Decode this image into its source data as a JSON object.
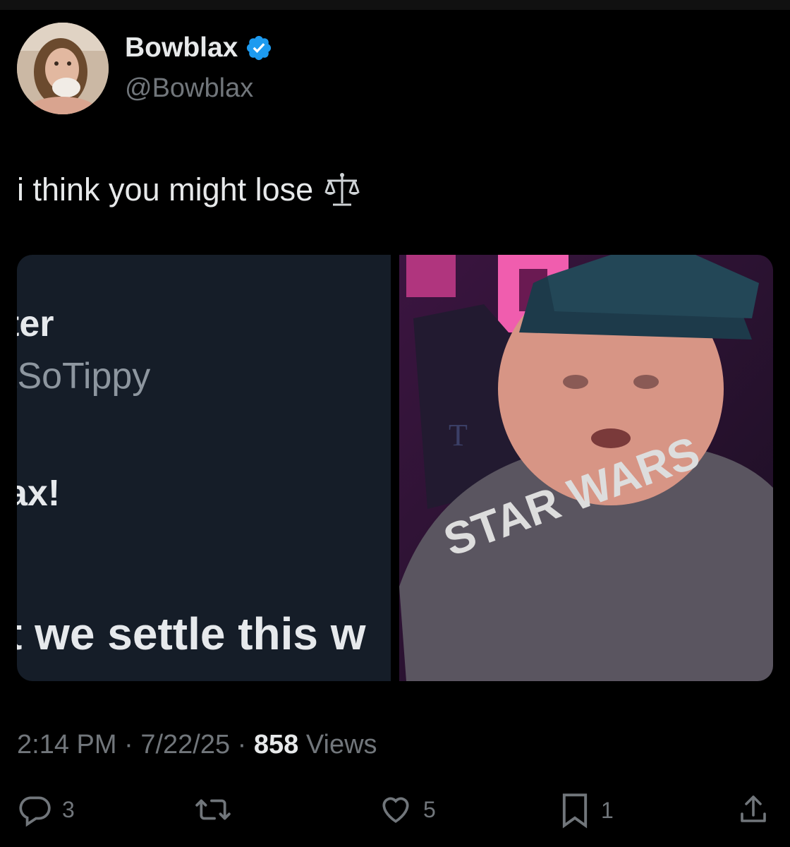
{
  "author": {
    "display_name": "Bowblax",
    "handle": "@Bowblax",
    "verified_icon": "verified-badge-icon",
    "verified_color": "#1d9bf0"
  },
  "tweet": {
    "text": "i think you might lose",
    "emoji_icon": "balance-scale-icon"
  },
  "media": {
    "left_panel": {
      "name_fragment": "ter",
      "handle_fragment": "tSoTippy",
      "mention_fragment": "ax!",
      "body_fragment": "t we settle this w"
    },
    "right_panel": {
      "chair_letter": "T",
      "shirt_text": "STAR WARS"
    }
  },
  "meta": {
    "time": "2:14 PM",
    "separator": " · ",
    "date": "7/22/25",
    "views_count": "858",
    "views_label": " Views"
  },
  "actions": {
    "replies": "3",
    "reposts": "",
    "likes": "5",
    "bookmarks": "1"
  },
  "colors": {
    "background": "#000000",
    "text_primary": "#e7e9ea",
    "text_secondary": "#71767b",
    "accent": "#1d9bf0"
  }
}
